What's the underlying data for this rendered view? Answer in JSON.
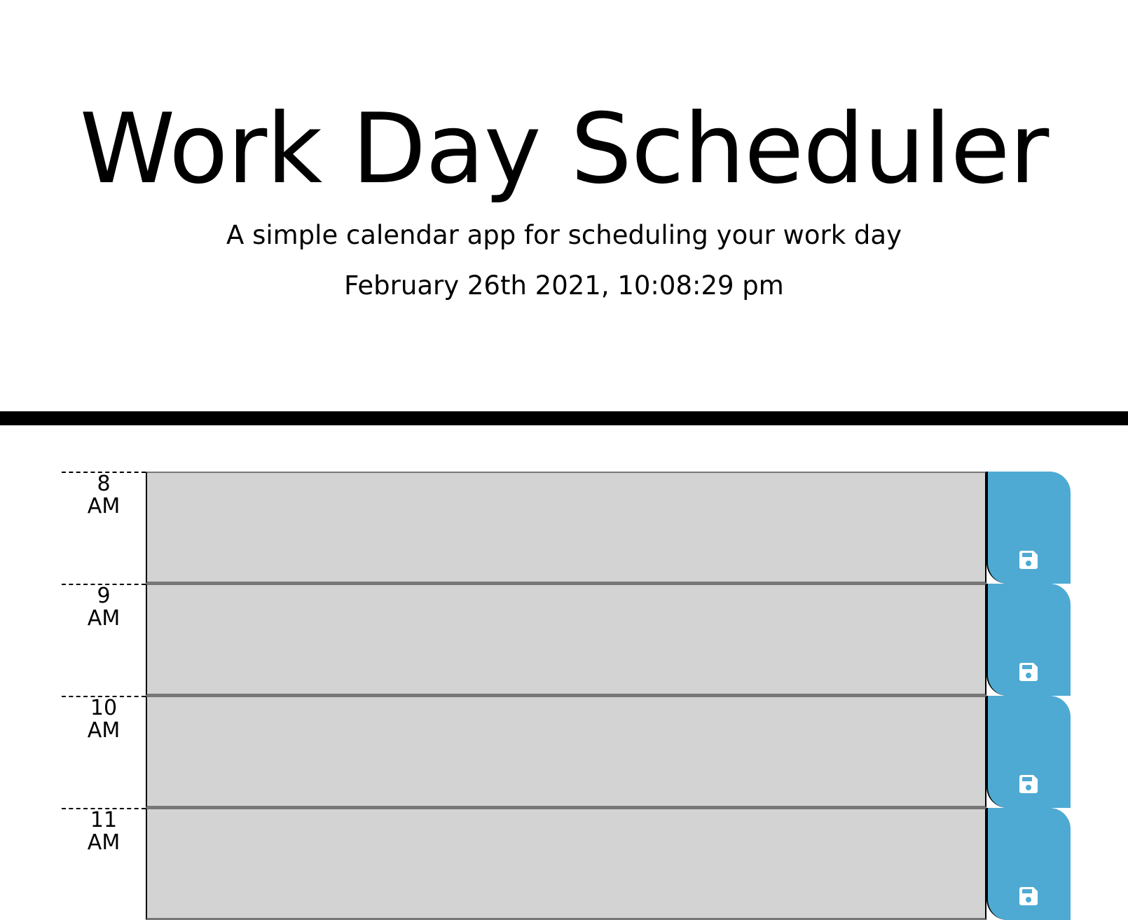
{
  "header": {
    "title": "Work Day Scheduler",
    "subtitle": "A simple calendar app for scheduling your work day",
    "current_datetime": "February 26th 2021, 10:08:29 pm"
  },
  "time_blocks": [
    {
      "hour": "8",
      "period": "AM",
      "text": ""
    },
    {
      "hour": "9",
      "period": "AM",
      "text": ""
    },
    {
      "hour": "10",
      "period": "AM",
      "text": ""
    },
    {
      "hour": "11",
      "period": "AM",
      "text": ""
    }
  ],
  "colors": {
    "save_button": "#4eaad3",
    "past_block": "#d3d3d3",
    "header_rule": "#000000"
  },
  "icons": {
    "save": "floppy-disk-icon"
  }
}
